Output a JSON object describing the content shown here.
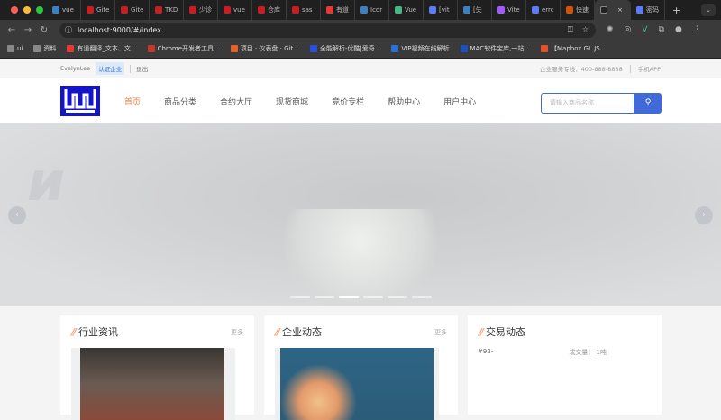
{
  "browser": {
    "tabs": [
      {
        "label": "vue",
        "color": "#3b82c4"
      },
      {
        "label": "Gite",
        "color": "#c71d23"
      },
      {
        "label": "Gite",
        "color": "#c71d23"
      },
      {
        "label": "TKD",
        "color": "#c71d23"
      },
      {
        "label": "少诊",
        "color": "#c71d23"
      },
      {
        "label": "vue",
        "color": "#c71d23"
      },
      {
        "label": "仓库",
        "color": "#c71d23"
      },
      {
        "label": "sas",
        "color": "#c71d23"
      },
      {
        "label": "有道",
        "color": "#e53935"
      },
      {
        "label": "Icor",
        "color": "#3b82c4"
      },
      {
        "label": "Vue",
        "color": "#42b883"
      },
      {
        "label": "[vit",
        "color": "#5c7cfa"
      },
      {
        "label": "[矢",
        "color": "#3b82c4"
      },
      {
        "label": "Vite",
        "color": "#a259ff"
      },
      {
        "label": "errc",
        "color": "#5c7cfa"
      },
      {
        "label": "快速",
        "color": "#d35400"
      }
    ],
    "active_tab_close": "×",
    "last_tab": "密码",
    "new_tab": "+",
    "url": "localhost:9000/#/index",
    "bookmarks": [
      {
        "label": "ui",
        "color": "#888"
      },
      {
        "label": "资料",
        "color": "#888"
      },
      {
        "label": "有道翻译_文本、文...",
        "color": "#e53935"
      },
      {
        "label": "Chrome开发者工具...",
        "color": "#c0392b"
      },
      {
        "label": "项目 · 仪表盘 · Git...",
        "color": "#e2632a"
      },
      {
        "label": "全能解析-优酷|爱奇...",
        "color": "#2b4fd8"
      },
      {
        "label": "VIP视频在线解析",
        "color": "#2c6fd6"
      },
      {
        "label": "MAC软件宝库,一站...",
        "color": "#1f4fb8"
      },
      {
        "label": "【Mapbox GL JS...",
        "color": "#e2532a"
      }
    ]
  },
  "topbar": {
    "user": "EvelynLee",
    "cert": "认证企业",
    "logout": "退出",
    "hotline": "企业服务专线：400-888-8888",
    "app": "手机APP"
  },
  "nav": {
    "items": [
      "首页",
      "商品分类",
      "合约大厅",
      "现货商城",
      "竞价专栏",
      "帮助中心",
      "用户中心"
    ],
    "active": 0
  },
  "search": {
    "placeholder": "请输入商品名称"
  },
  "banner": {
    "slides": 6,
    "active": 2
  },
  "cards": [
    {
      "title": "行业资讯",
      "more": "更多"
    },
    {
      "title": "企业动态",
      "more": "更多"
    },
    {
      "title": "交易动态",
      "row": {
        "name": "#92-",
        "volume": "成交量：  1吨"
      }
    }
  ],
  "colors": {
    "accent": "#f07a3a",
    "primary": "#3f6ad8",
    "logo": "#1414c8"
  }
}
